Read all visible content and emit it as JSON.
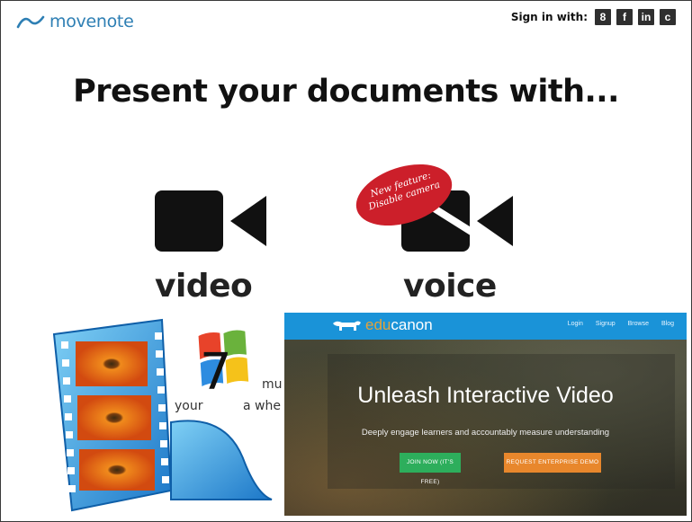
{
  "header": {
    "logo_text": "movenote",
    "signin_label": "Sign in with:",
    "social_icons": [
      {
        "name": "google-plus-icon",
        "glyph": "8"
      },
      {
        "name": "facebook-icon",
        "glyph": "f"
      },
      {
        "name": "linkedin-icon",
        "glyph": "in"
      },
      {
        "name": "other-icon",
        "glyph": "c"
      }
    ]
  },
  "headline": "Present your documents with...",
  "options": {
    "video_label": "video",
    "voice_label": "voice",
    "badge_line1": "New feature:",
    "badge_line2": "Disable camera"
  },
  "fragments": {
    "line1": "mu",
    "line2_a": "your",
    "line2_b": "a whe"
  },
  "windows_logo_number": "7",
  "educanon": {
    "logo_prefix": "edu",
    "logo_suffix": "canon",
    "nav": [
      "Login",
      "Signup",
      "Browse",
      "Blog"
    ],
    "title": "Unleash Interactive Video",
    "subtitle": "Deeply engage learners and accountably measure understanding",
    "join_button": "JOIN NOW (IT'S FREE)",
    "demo_button": "REQUEST ENTERPRISE DEMO"
  },
  "colors": {
    "logo_blue": "#2e7fb4",
    "badge_red": "#cc1f2a",
    "edu_nav_blue": "#1a93d8",
    "join_green": "#2dae5c",
    "demo_orange": "#e8872c"
  }
}
